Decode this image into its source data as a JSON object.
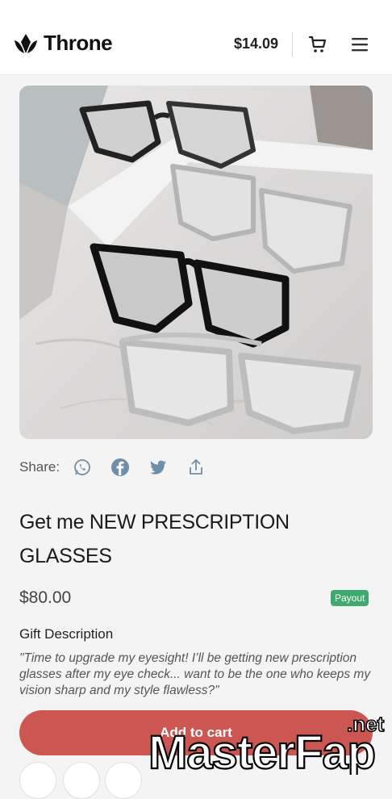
{
  "header": {
    "brand": "Throne",
    "balance": "$14.09",
    "icons": {
      "logo": "crown-icon",
      "cart": "cart-icon",
      "menu": "menu-icon"
    }
  },
  "product": {
    "image": "glasses-photo",
    "share_label": "Share:",
    "share_icons": [
      "whatsapp-icon",
      "facebook-icon",
      "twitter-icon",
      "share-export-icon"
    ],
    "title": "Get me NEW PRESCRIPTION GLASSES",
    "price": "$80.00",
    "badge": "Payout",
    "description_heading": "Gift Description",
    "description": "\"Time to upgrade my eyesight! I’ll be getting new prescription glasses after my eye check... want to be the one who keeps my vision sharp and my style flawless?\"",
    "add_to_cart": "Add to cart"
  },
  "watermark": {
    "main": "MasterFap",
    "suffix": ".net"
  },
  "colors": {
    "accent": "#cc5752",
    "badge": "#3eaa6e",
    "share_icon": "#6f8ea8"
  }
}
